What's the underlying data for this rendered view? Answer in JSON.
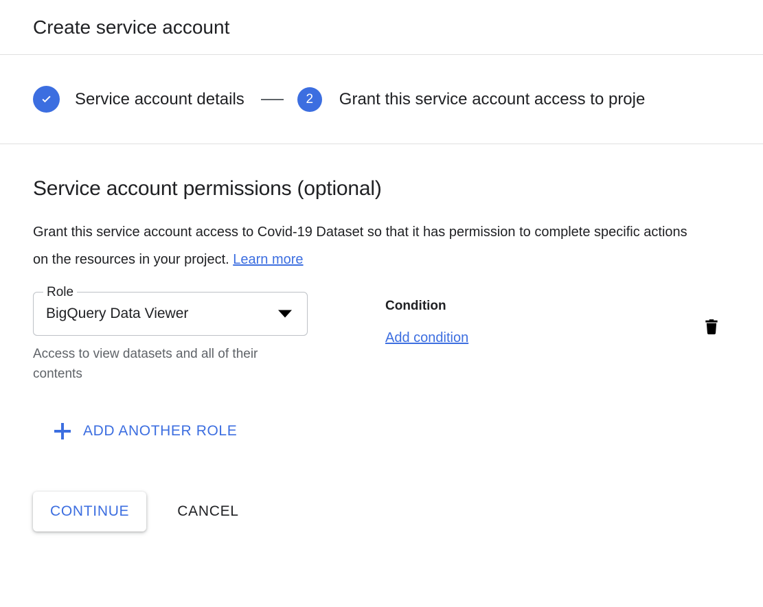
{
  "header": {
    "title": "Create service account"
  },
  "stepper": {
    "steps": [
      {
        "label": "Service account details",
        "state": "completed",
        "marker": "check-icon"
      },
      {
        "label": "Grant this service account access to proje",
        "state": "active",
        "marker": "2"
      }
    ]
  },
  "permissions": {
    "section_title": "Service account permissions (optional)",
    "description_part1": "Grant this service account access to Covid-19 Dataset so that it has permission to complete specific actions on the resources in your project.",
    "learn_more_label": "Learn more",
    "role": {
      "field_label": "Role",
      "selected_value": "BigQuery Data Viewer",
      "helper_text": "Access to view datasets and all of their contents"
    },
    "condition": {
      "label": "Condition",
      "add_condition_label": "Add condition"
    },
    "delete_icon": "trash-icon",
    "add_another_role_label": "ADD ANOTHER ROLE"
  },
  "footer": {
    "continue_label": "CONTINUE",
    "cancel_label": "CANCEL"
  },
  "colors": {
    "accent_blue": "#3c6ee0",
    "text_primary": "#202124",
    "text_secondary": "#5f6368",
    "divider": "#e0e0e0",
    "field_border": "#bdc1c6"
  }
}
